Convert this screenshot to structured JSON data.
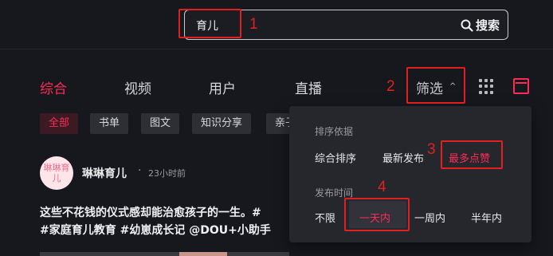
{
  "search": {
    "value": "育儿",
    "button_label": "搜索"
  },
  "tabs": [
    {
      "label": "综合",
      "active": true
    },
    {
      "label": "视频",
      "active": false
    },
    {
      "label": "用户",
      "active": false
    },
    {
      "label": "直播",
      "active": false
    }
  ],
  "filter": {
    "label": "筛选"
  },
  "chips": [
    {
      "label": "全部",
      "active": true
    },
    {
      "label": "书单",
      "active": false
    },
    {
      "label": "图文",
      "active": false
    },
    {
      "label": "知识分享",
      "active": false
    },
    {
      "label": "亲子",
      "active": false
    }
  ],
  "filter_panel": {
    "sort_title": "排序依据",
    "sort_options": [
      {
        "label": "综合排序",
        "active": false
      },
      {
        "label": "最新发布",
        "active": false
      },
      {
        "label": "最多点赞",
        "active": true
      }
    ],
    "time_title": "发布时间",
    "time_options": [
      {
        "label": "不限",
        "active": false
      },
      {
        "label": "一天内",
        "active": true
      },
      {
        "label": "一周内",
        "active": false
      },
      {
        "label": "半年内",
        "active": false
      }
    ]
  },
  "post": {
    "avatar_text": "琳琳育儿",
    "author": "琳琳育儿",
    "separator": "·",
    "time": "23小时前",
    "caption_line1": "这些不花钱的仪式感却能治愈孩子的一生。#",
    "caption_line2": "#家庭育儿教育 #幼崽成长记 @DOU+小助手"
  },
  "annotations": [
    "1",
    "2",
    "3",
    "4"
  ],
  "colors": {
    "accent": "#fe2c55",
    "annotation": "#e02020",
    "background": "#17181e",
    "panel": "#26272d"
  },
  "icons": {
    "search": "search-icon",
    "grid_view": "grid-view-icon",
    "list_view": "list-view-icon",
    "chevron": "chevron-up-icon"
  }
}
